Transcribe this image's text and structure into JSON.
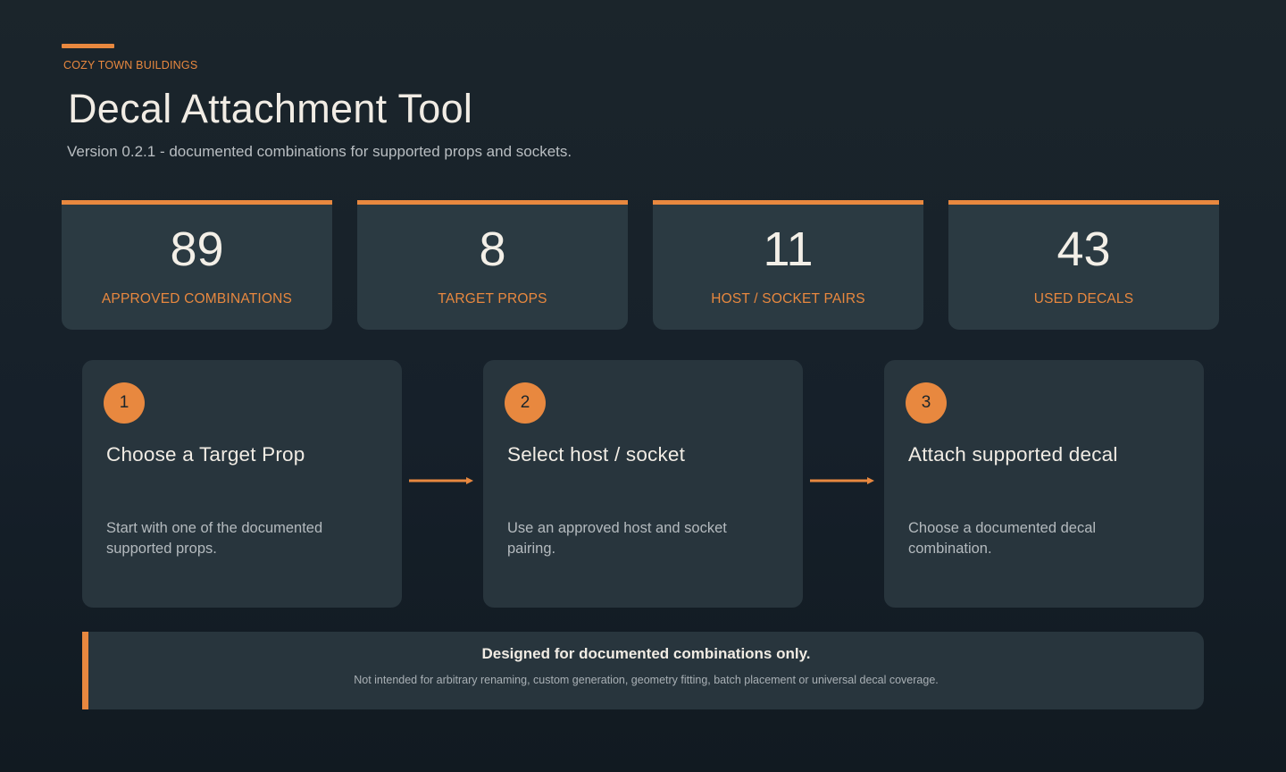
{
  "header": {
    "eyebrow": "COZY TOWN BUILDINGS",
    "title": "Decal Attachment Tool",
    "subtitle": "Version 0.2.1 - documented combinations for supported props and sockets."
  },
  "stats": [
    {
      "value": "89",
      "label": "APPROVED COMBINATIONS"
    },
    {
      "value": "8",
      "label": "TARGET PROPS"
    },
    {
      "value": "11",
      "label": "HOST / SOCKET PAIRS"
    },
    {
      "value": "43",
      "label": "USED DECALS"
    }
  ],
  "steps": [
    {
      "number": "1",
      "title": "Choose a Target Prop",
      "description": "Start with one of the documented supported props."
    },
    {
      "number": "2",
      "title": "Select host / socket",
      "description": "Use an approved host and socket pairing."
    },
    {
      "number": "3",
      "title": "Attach supported decal",
      "description": "Choose a documented decal combination."
    }
  ],
  "notice": {
    "title": "Designed for documented combinations only.",
    "text": "Not intended for arbitrary renaming, custom generation, geometry fitting, batch placement or universal decal coverage."
  },
  "colors": {
    "accent": "#e8883f",
    "card": "#2b3a42",
    "background": "#18222a"
  },
  "icons": [
    "arrow-right-icon"
  ]
}
